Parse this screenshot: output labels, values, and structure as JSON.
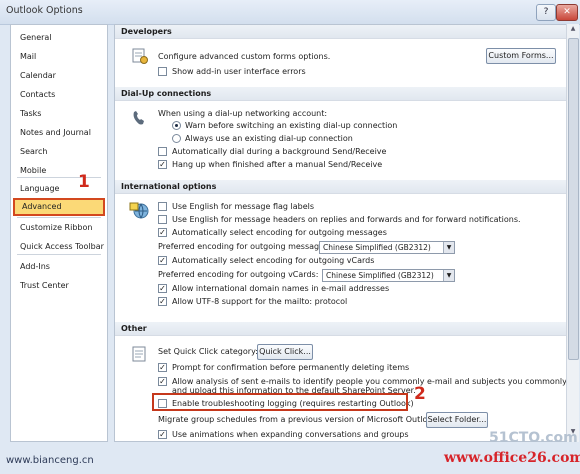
{
  "window": {
    "title": "Outlook Options",
    "help_button": "?",
    "close_button": "✕"
  },
  "nav": {
    "items": [
      {
        "label": "General"
      },
      {
        "label": "Mail"
      },
      {
        "label": "Calendar"
      },
      {
        "label": "Contacts"
      },
      {
        "label": "Tasks"
      },
      {
        "label": "Notes and Journal"
      },
      {
        "label": "Search"
      },
      {
        "label": "Mobile"
      },
      {
        "label": "Language"
      },
      {
        "label": "Advanced"
      },
      {
        "label": "Customize Ribbon"
      },
      {
        "label": "Quick Access Toolbar"
      },
      {
        "label": "Add-Ins"
      },
      {
        "label": "Trust Center"
      }
    ],
    "selected": "Advanced"
  },
  "sections": {
    "developers": {
      "title": "Developers",
      "configure_text": "Configure advanced custom forms options.",
      "custom_forms_button": "Custom Forms...",
      "show_addin_errors": "Show add-in user interface errors"
    },
    "dialup": {
      "title": "Dial-Up connections",
      "when_using": "When using a dial-up networking account:",
      "warn_before": "Warn before switching an existing dial-up connection",
      "always_use": "Always use an existing dial-up connection",
      "auto_dial": "Automatically dial during a background Send/Receive",
      "hang_up": "Hang up when finished after a manual Send/Receive"
    },
    "international": {
      "title": "International options",
      "english_flags": "Use English for message flag labels",
      "english_headers": "Use English for message headers on replies and forwards and for forward notifications.",
      "auto_encoding": "Automatically select encoding for outgoing messages",
      "pref_encoding_label": "Preferred encoding for outgoing messages:",
      "pref_encoding_value": "Chinese Simplified (GB2312)",
      "auto_vcards": "Automatically select encoding for outgoing vCards",
      "pref_vcards_label": "Preferred encoding for outgoing vCards:",
      "pref_vcards_value": "Chinese Simplified (GB2312)",
      "intl_domain": "Allow international domain names in e-mail addresses",
      "utf8_mailto": "Allow UTF-8 support for the mailto: protocol"
    },
    "other": {
      "title": "Other",
      "quick_click_label": "Set Quick Click category:",
      "quick_click_button": "Quick Click...",
      "prompt_delete": "Prompt for confirmation before permanently deleting items",
      "analysis_line1": "Allow analysis of sent e-mails to identify people you commonly e-mail and subjects you commonly discuss,",
      "analysis_line2": "and upload this information to the default SharePoint Server.",
      "troubleshooting": "Enable troubleshooting logging (requires restarting Outlook)",
      "migrate_label": "Migrate group schedules from a previous version of Microsoft Outlook:",
      "select_folder_button": "Select Folder...",
      "animations": "Use animations when expanding conversations and groups"
    }
  },
  "annotations": {
    "marker1": "1",
    "marker2": "2"
  },
  "watermarks": {
    "left": "www.bianceng.cn",
    "right_top": "51CTO.com",
    "right": "www.office26.com"
  },
  "colors": {
    "selection": "#fbd977",
    "annotation_red": "#d02a1c",
    "window_bg": "#dfe8f3"
  }
}
